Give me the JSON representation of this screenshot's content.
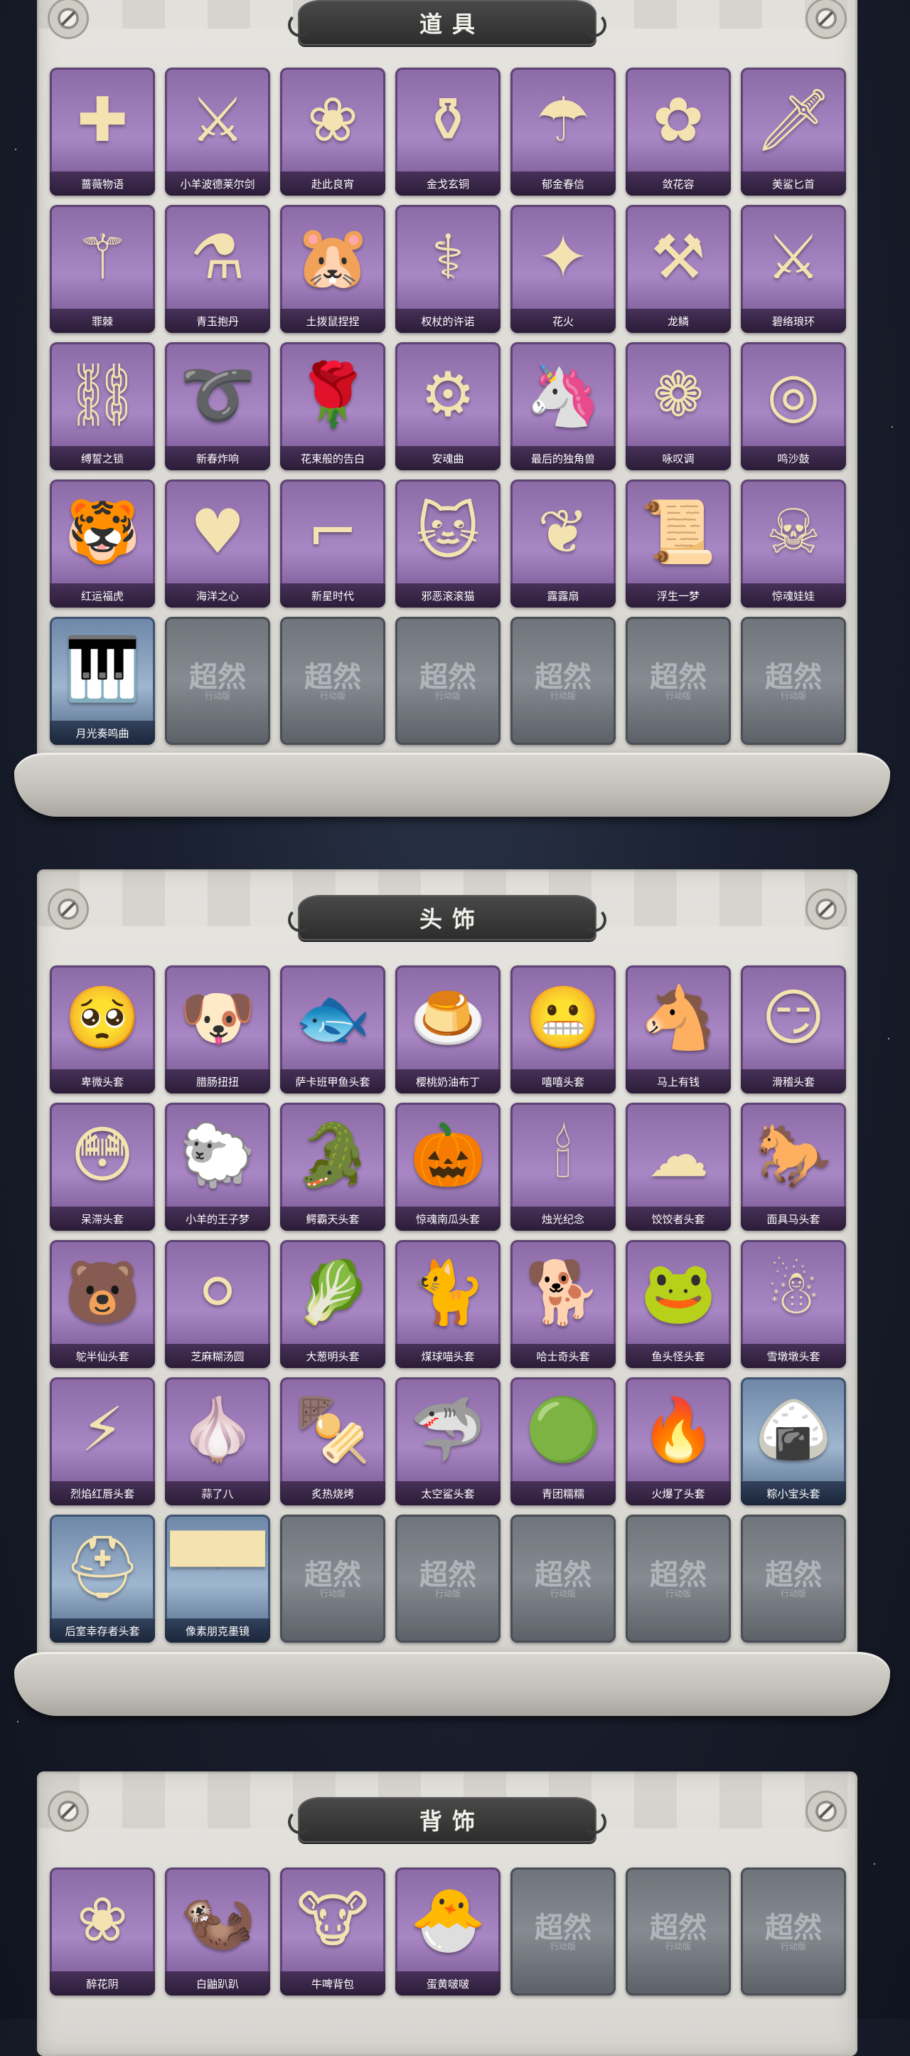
{
  "sections": [
    {
      "title": "道具",
      "items": [
        {
          "name": "蔷薇物语",
          "icon": "medical-bag-icon",
          "glyph": "✚"
        },
        {
          "name": "小羊波德莱尔剑",
          "icon": "sword-icon",
          "glyph": "⚔"
        },
        {
          "name": "赴此良宵",
          "icon": "folding-fan-icon",
          "glyph": "❀"
        },
        {
          "name": "金戈玄铜",
          "icon": "bronze-vessel-icon",
          "glyph": "⚱"
        },
        {
          "name": "郁金春信",
          "icon": "paper-umbrella-icon",
          "glyph": "☂"
        },
        {
          "name": "敛花容",
          "icon": "hairpin-icon",
          "glyph": "✿"
        },
        {
          "name": "美鲨匕首",
          "icon": "shark-dagger-icon",
          "glyph": "🗡"
        },
        {
          "name": "罪棘",
          "icon": "thorn-staff-icon",
          "glyph": "⚚"
        },
        {
          "name": "青玉抱丹",
          "icon": "jade-flask-icon",
          "glyph": "⚗"
        },
        {
          "name": "土拨鼠捏捏",
          "icon": "groundhog-plush-icon",
          "glyph": "🐹"
        },
        {
          "name": "权杖的许诺",
          "icon": "scepter-icon",
          "glyph": "⚕"
        },
        {
          "name": "花火",
          "icon": "firework-icon",
          "glyph": "✦"
        },
        {
          "name": "龙鳞",
          "icon": "golden-shovel-icon",
          "glyph": "⚒"
        },
        {
          "name": "碧络琅环",
          "icon": "jade-sword-icon",
          "glyph": "⚔"
        },
        {
          "name": "缚誓之锁",
          "icon": "chain-icon",
          "glyph": "⛓"
        },
        {
          "name": "新春炸响",
          "icon": "firecracker-whip-icon",
          "glyph": "➰"
        },
        {
          "name": "花束般的告白",
          "icon": "rose-icon",
          "glyph": "🌹"
        },
        {
          "name": "安魂曲",
          "icon": "chainsaw-icon",
          "glyph": "⚙"
        },
        {
          "name": "最后的独角兽",
          "icon": "unicorn-horn-icon",
          "glyph": "🦄"
        },
        {
          "name": "咏叹调",
          "icon": "flower-lantern-icon",
          "glyph": "❁"
        },
        {
          "name": "鸣沙鼓",
          "icon": "sand-drum-icon",
          "glyph": "◎"
        },
        {
          "name": "红运福虎",
          "icon": "tiger-pillow-icon",
          "glyph": "🐯"
        },
        {
          "name": "海洋之心",
          "icon": "heart-necklace-icon",
          "glyph": "♥"
        },
        {
          "name": "新星时代",
          "icon": "revolver-icon",
          "glyph": "⌐"
        },
        {
          "name": "邪恶滚滚猫",
          "icon": "purple-cat-icon",
          "glyph": "🐱"
        },
        {
          "name": "露露扇",
          "icon": "doll-fan-icon",
          "glyph": "❦"
        },
        {
          "name": "浮生一梦",
          "icon": "scroll-icon",
          "glyph": "📜"
        },
        {
          "name": "惊魂娃娃",
          "icon": "skull-doll-icon",
          "glyph": "☠"
        },
        {
          "name": "月光奏鸣曲",
          "icon": "piano-icon",
          "glyph": "🎹",
          "variant": "blue"
        },
        {
          "empty": true
        },
        {
          "empty": true
        },
        {
          "empty": true
        },
        {
          "empty": true
        },
        {
          "empty": true
        },
        {
          "empty": true
        }
      ]
    },
    {
      "title": "头饰",
      "items": [
        {
          "name": "卑微头套",
          "icon": "shy-face-icon",
          "glyph": "🥺"
        },
        {
          "name": "腊肠扭扭",
          "icon": "dachshund-icon",
          "glyph": "🐶"
        },
        {
          "name": "萨卡班甲鱼头套",
          "icon": "fish-head-icon",
          "glyph": "🐟"
        },
        {
          "name": "樱桃奶油布丁",
          "icon": "pudding-icon",
          "glyph": "🍮"
        },
        {
          "name": "嘻嘻头套",
          "icon": "grin-face-icon",
          "glyph": "😬"
        },
        {
          "name": "马上有钱",
          "icon": "red-horse-icon",
          "glyph": "🐴"
        },
        {
          "name": "滑稽头套",
          "icon": "smirk-face-icon",
          "glyph": "😏"
        },
        {
          "name": "呆滞头套",
          "icon": "dazed-face-icon",
          "glyph": "😳"
        },
        {
          "name": "小羊的王子梦",
          "icon": "sheep-crown-icon",
          "glyph": "🐑"
        },
        {
          "name": "鳄霸天头套",
          "icon": "crocodile-icon",
          "glyph": "🐊"
        },
        {
          "name": "惊魂南瓜头套",
          "icon": "pumpkin-icon",
          "glyph": "🎃"
        },
        {
          "name": "烛光纪念",
          "icon": "candle-icon",
          "glyph": "🕯"
        },
        {
          "name": "饺饺者头套",
          "icon": "dumpling-icon",
          "glyph": "☁"
        },
        {
          "name": "面具马头套",
          "icon": "horse-mask-icon",
          "glyph": "🐎"
        },
        {
          "name": "鸵半仙头套",
          "icon": "bear-sunglasses-icon",
          "glyph": "🐻"
        },
        {
          "name": "芝麻糊汤圆",
          "icon": "rice-ball-icon",
          "glyph": "⚪"
        },
        {
          "name": "大葱明头套",
          "icon": "scallion-icon",
          "glyph": "🥬"
        },
        {
          "name": "煤球喵头套",
          "icon": "grey-cat-icon",
          "glyph": "🐈"
        },
        {
          "name": "哈士奇头套",
          "icon": "husky-icon",
          "glyph": "🐕"
        },
        {
          "name": "鱼头怪头套",
          "icon": "fish-monster-icon",
          "glyph": "🐸"
        },
        {
          "name": "雪墩墩头套",
          "icon": "snowman-icon",
          "glyph": "☃"
        },
        {
          "name": "烈焰红唇头套",
          "icon": "pikachu-icon",
          "glyph": "⚡"
        },
        {
          "name": "蒜了八",
          "icon": "garlic-icon",
          "glyph": "🧄"
        },
        {
          "name": "炙热烧烤",
          "icon": "skewer-icon",
          "glyph": "🍢"
        },
        {
          "name": "太空鲨头套",
          "icon": "space-shark-icon",
          "glyph": "🦈"
        },
        {
          "name": "青团糯糯",
          "icon": "green-ball-icon",
          "glyph": "🟢"
        },
        {
          "name": "火爆了头套",
          "icon": "fire-spirit-icon",
          "glyph": "🔥"
        },
        {
          "name": "粽小宝头套",
          "icon": "zongzi-icon",
          "glyph": "🍙",
          "variant": "blue"
        },
        {
          "name": "后室幸存者头套",
          "icon": "gas-mask-icon",
          "glyph": "⛑",
          "variant": "blue"
        },
        {
          "name": "像素朋克墨镜",
          "icon": "pixel-glasses-icon",
          "glyph": "▀▀",
          "variant": "blue"
        },
        {
          "empty": true
        },
        {
          "empty": true
        },
        {
          "empty": true
        },
        {
          "empty": true
        },
        {
          "empty": true
        }
      ]
    },
    {
      "title": "背饰",
      "items": [
        {
          "name": "醉花阴",
          "icon": "flower-wreath-icon",
          "glyph": "❀"
        },
        {
          "name": "白鼬趴趴",
          "icon": "ferret-icon",
          "glyph": "🦦"
        },
        {
          "name": "牛啤背包",
          "icon": "cow-barrel-icon",
          "glyph": "🐮"
        },
        {
          "name": "蛋黄啵啵",
          "icon": "chick-egg-icon",
          "glyph": "🐣"
        },
        {
          "empty": true
        },
        {
          "empty": true
        },
        {
          "empty": true
        }
      ]
    }
  ],
  "placeholder": {
    "watermark": "超然",
    "subtitle": "行动版"
  }
}
